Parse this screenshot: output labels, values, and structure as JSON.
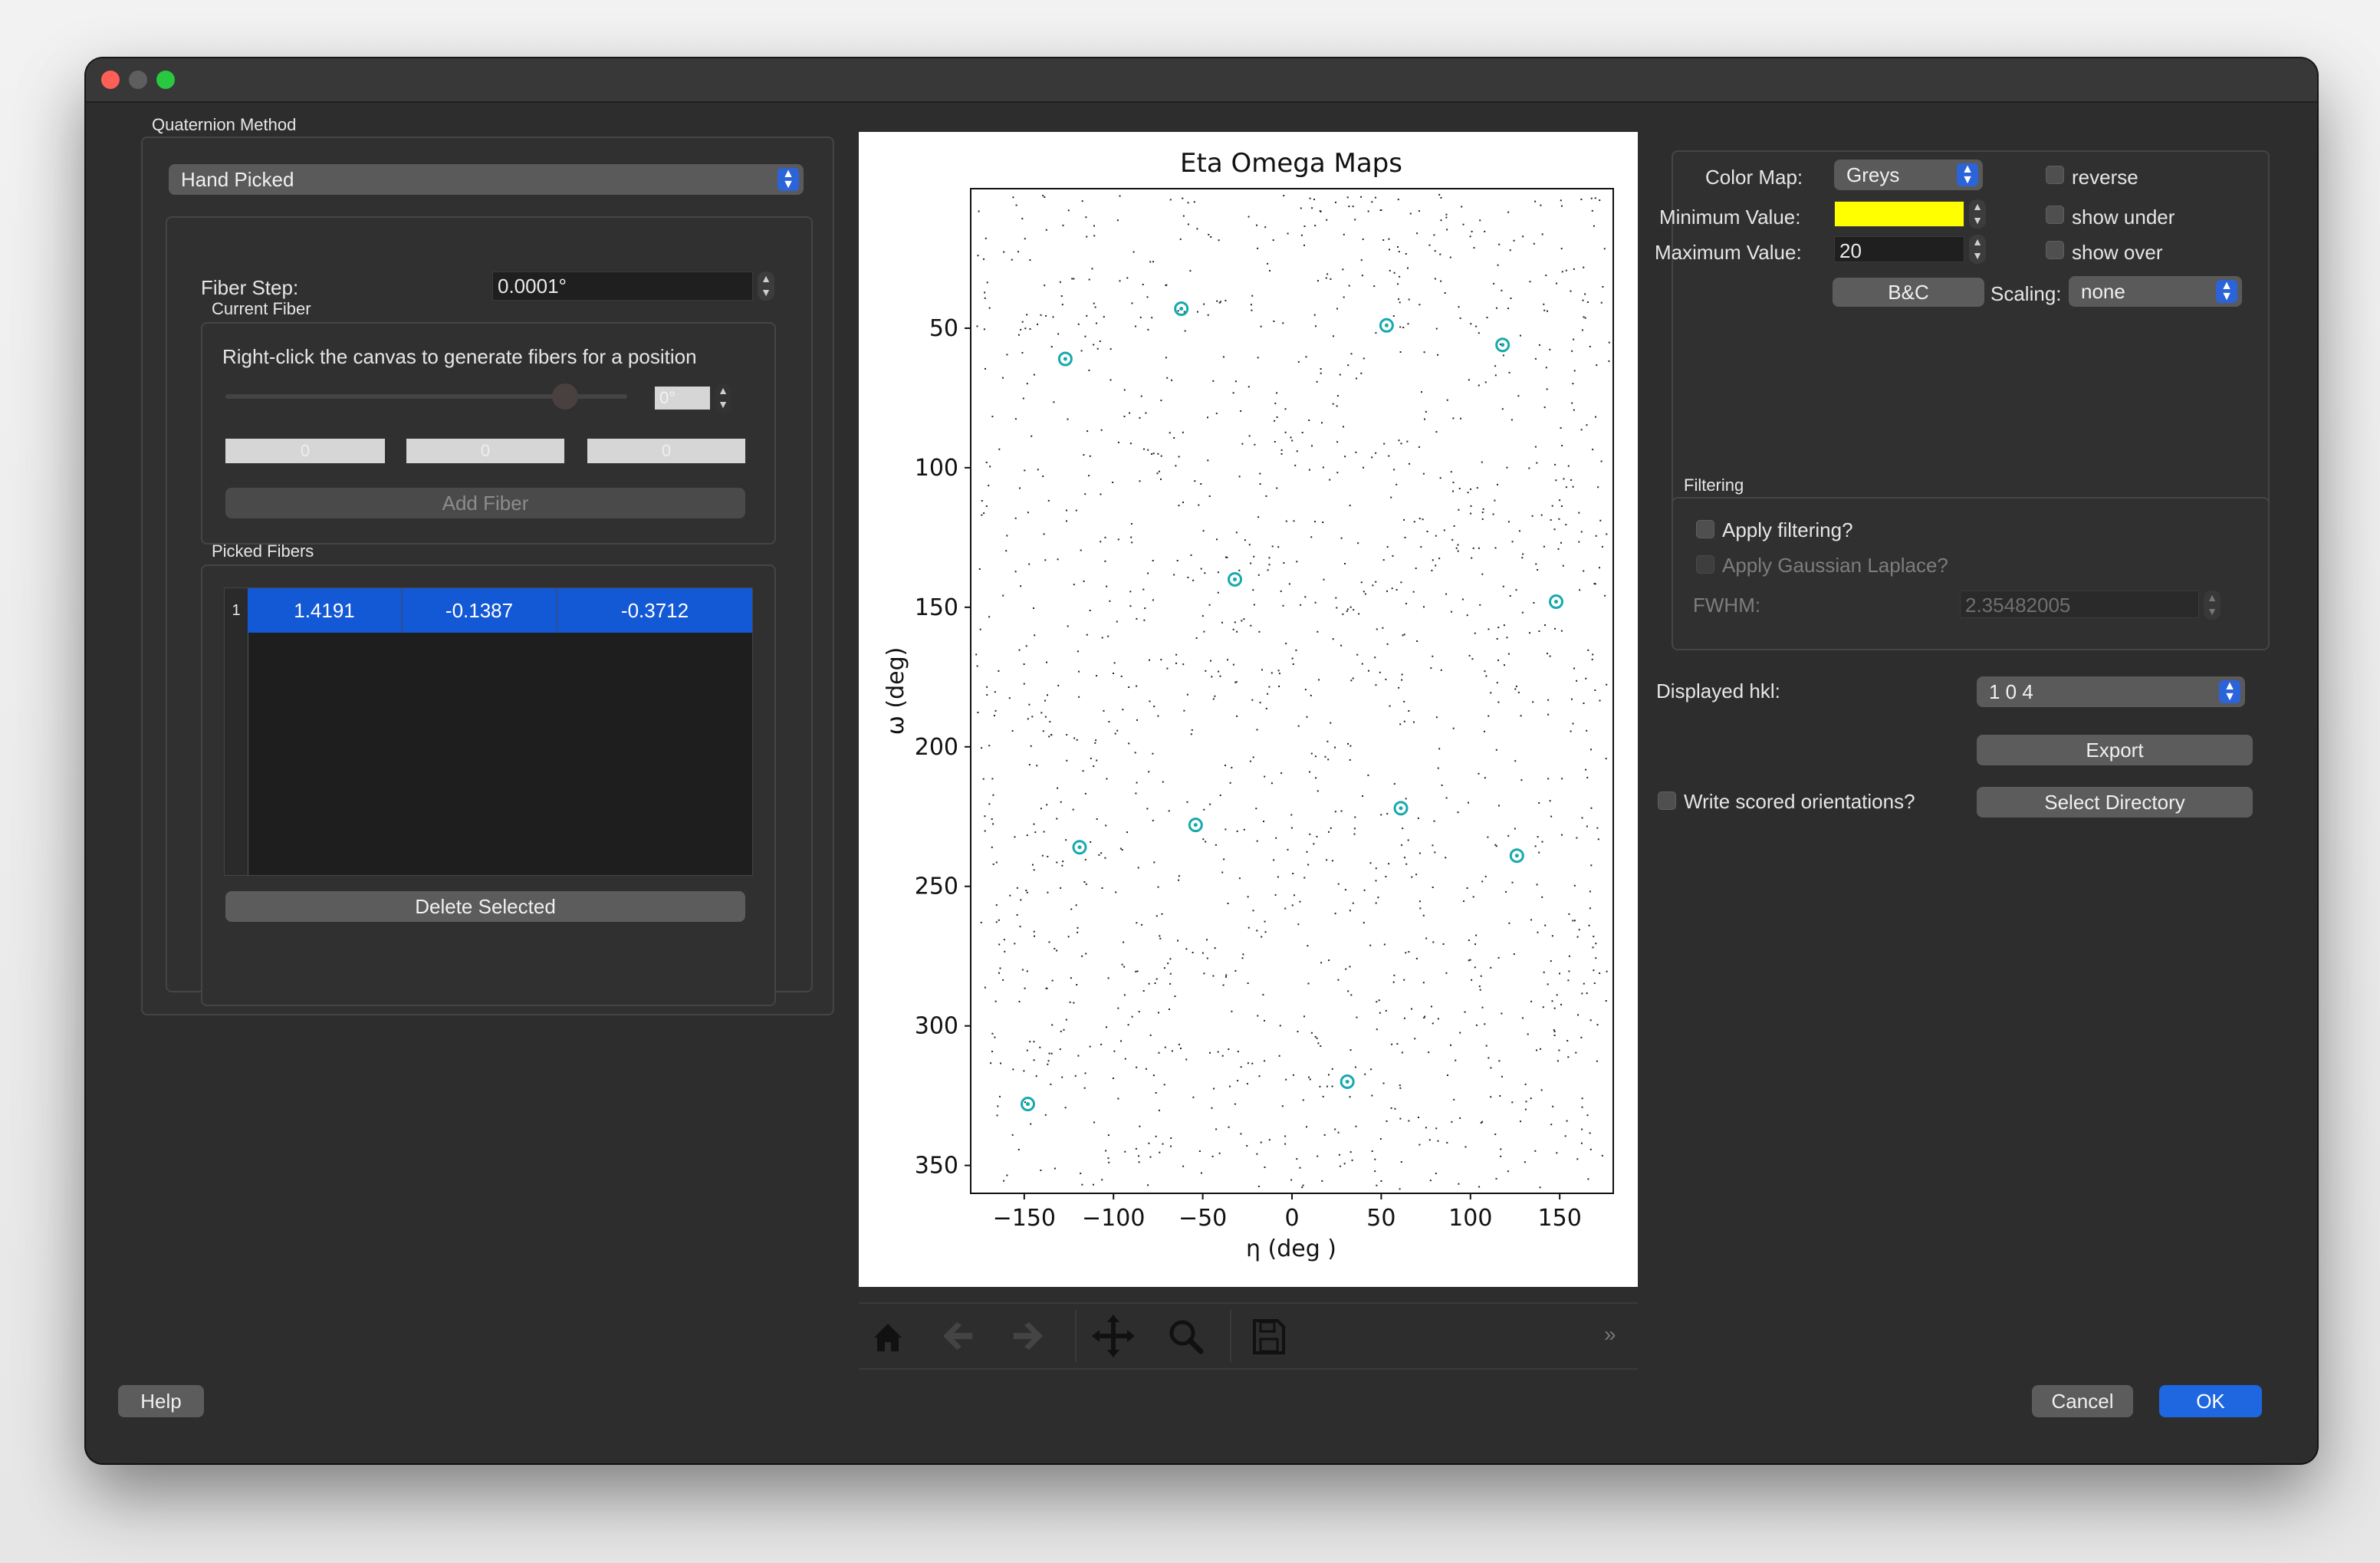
{
  "window": {
    "traffic_lights": [
      "close",
      "minimize",
      "maximize"
    ]
  },
  "left": {
    "quaternion_group_title": "Quaternion Method",
    "method_combo_value": "Hand Picked",
    "fiber_step_label": "Fiber Step:",
    "fiber_step_value": "0.0001°",
    "current_fiber_title": "Current Fiber",
    "instruction": "Right-click the canvas to generate fibers for a position",
    "slider_value": "0°",
    "fiber_fields": [
      "0",
      "0",
      "0"
    ],
    "add_fiber_label": "Add Fiber",
    "picked_fibers_title": "Picked Fibers",
    "table_rows": [
      {
        "index": "1",
        "values": [
          "1.4191",
          "-0.1387",
          "-0.3712"
        ]
      }
    ],
    "delete_selected_label": "Delete Selected"
  },
  "plot": {
    "toolbar_icons": [
      "home-icon",
      "back-arrow-icon",
      "forward-arrow-icon",
      "pan-icon",
      "zoom-icon",
      "save-icon"
    ],
    "overflow_glyph": "»"
  },
  "chart_data": {
    "type": "scatter",
    "title": "Eta Omega Maps",
    "xlabel": "η (deg )",
    "ylabel": "ω (deg)",
    "xlim": [
      -180,
      180
    ],
    "ylim": [
      360,
      0
    ],
    "y_inverted": true,
    "xticks": [
      -150,
      -100,
      -50,
      0,
      50,
      100,
      150
    ],
    "xtick_labels": [
      "−150",
      "−100",
      "−50",
      "0",
      "50",
      "100",
      "150"
    ],
    "yticks": [
      50,
      100,
      150,
      200,
      250,
      300,
      350
    ],
    "ytick_labels": [
      "50",
      "100",
      "150",
      "200",
      "250",
      "300",
      "350"
    ],
    "background": "sparse black noise dots on white",
    "marker_color": "#17a9ad",
    "series": [
      {
        "points": [
          {
            "x": -62,
            "y": 43
          },
          {
            "x": 53,
            "y": 49
          },
          {
            "x": -127,
            "y": 61
          },
          {
            "x": 118,
            "y": 56
          },
          {
            "x": -32,
            "y": 140
          },
          {
            "x": 148,
            "y": 148
          },
          {
            "x": 61,
            "y": 222
          },
          {
            "x": -54,
            "y": 228
          },
          {
            "x": -119,
            "y": 236
          },
          {
            "x": 126,
            "y": 239
          },
          {
            "x": -148,
            "y": 328
          },
          {
            "x": 31,
            "y": 320
          }
        ]
      }
    ]
  },
  "right": {
    "color_map_label": "Color Map:",
    "color_map_value": "Greys",
    "reverse_label": "reverse",
    "min_label": "Minimum Value:",
    "min_value": "",
    "min_color": "#ffff00",
    "show_under_label": "show under",
    "max_label": "Maximum Value:",
    "max_value": "20",
    "show_over_label": "show over",
    "bc_label": "B&C",
    "scaling_label": "Scaling:",
    "scaling_value": "none",
    "filtering_title": "Filtering",
    "apply_filtering_label": "Apply filtering?",
    "apply_gaussian_label": "Apply Gaussian Laplace?",
    "fwhm_label": "FWHM:",
    "fwhm_value": "2.35482005",
    "displayed_hkl_label": "Displayed hkl:",
    "displayed_hkl_value": "1 0 4",
    "export_label": "Export",
    "write_scored_label": "Write scored orientations?",
    "select_directory_label": "Select Directory"
  },
  "footer": {
    "help_label": "Help",
    "cancel_label": "Cancel",
    "ok_label": "OK"
  }
}
